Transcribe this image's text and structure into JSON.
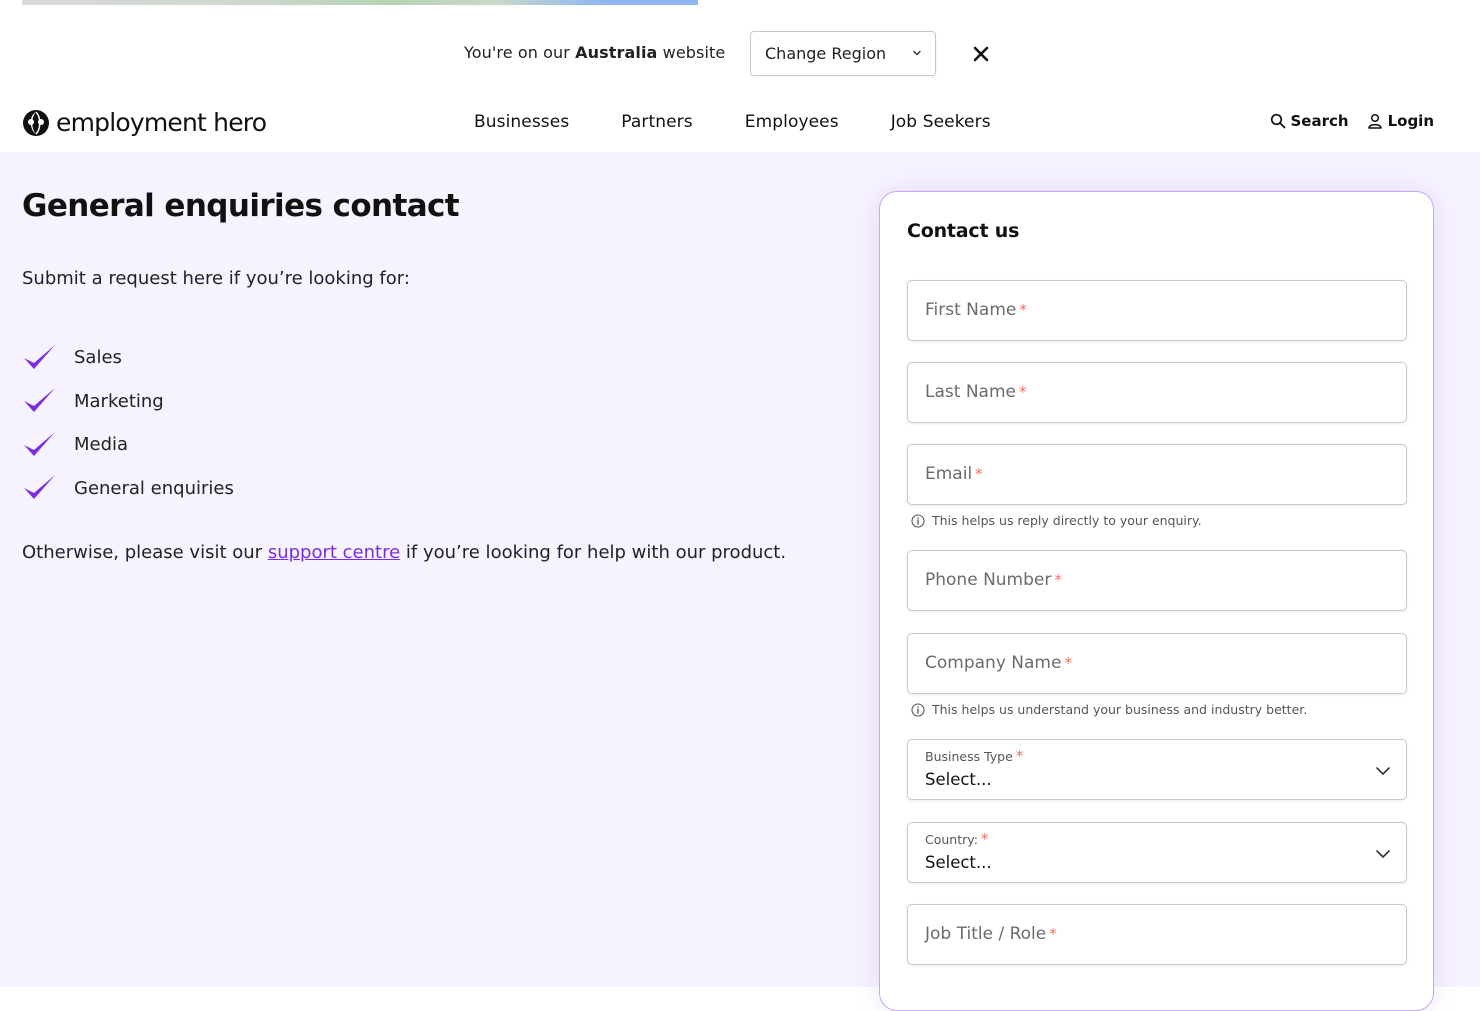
{
  "region_banner": {
    "prefix": "You're on our",
    "country": "Australia",
    "suffix": "website",
    "select_label": "Change Region"
  },
  "nav": {
    "brand": "employment hero",
    "links": [
      "Businesses",
      "Partners",
      "Employees",
      "Job Seekers"
    ],
    "search_label": "Search",
    "login_label": "Login"
  },
  "main": {
    "title": "General enquiries contact",
    "intro": "Submit a request here if you’re looking for:",
    "checklist": [
      "Sales",
      "Marketing",
      "Media",
      "General enquiries"
    ],
    "otherwise_before": "Otherwise, please visit our",
    "support_link": "support centre",
    "otherwise_after": "if you’re looking for help with our product."
  },
  "form": {
    "title": "Contact us",
    "required_mark": "*",
    "first_name": "First Name",
    "last_name": "Last Name",
    "email": "Email",
    "email_hint": "This helps us reply directly to your enquiry.",
    "phone": "Phone Number",
    "company": "Company Name",
    "company_hint": "This helps us understand your business and industry better.",
    "business_type_label": "Business Type",
    "business_type_value": "Select...",
    "country_label": "Country:",
    "country_value": "Select...",
    "job_title": "Job Title / Role"
  },
  "colors": {
    "accent": "#7b2ee0",
    "check": "#7b2ee0",
    "content_bg": "#f6f2fe",
    "card_border": "#c7a8f5",
    "required": "#f07060"
  }
}
